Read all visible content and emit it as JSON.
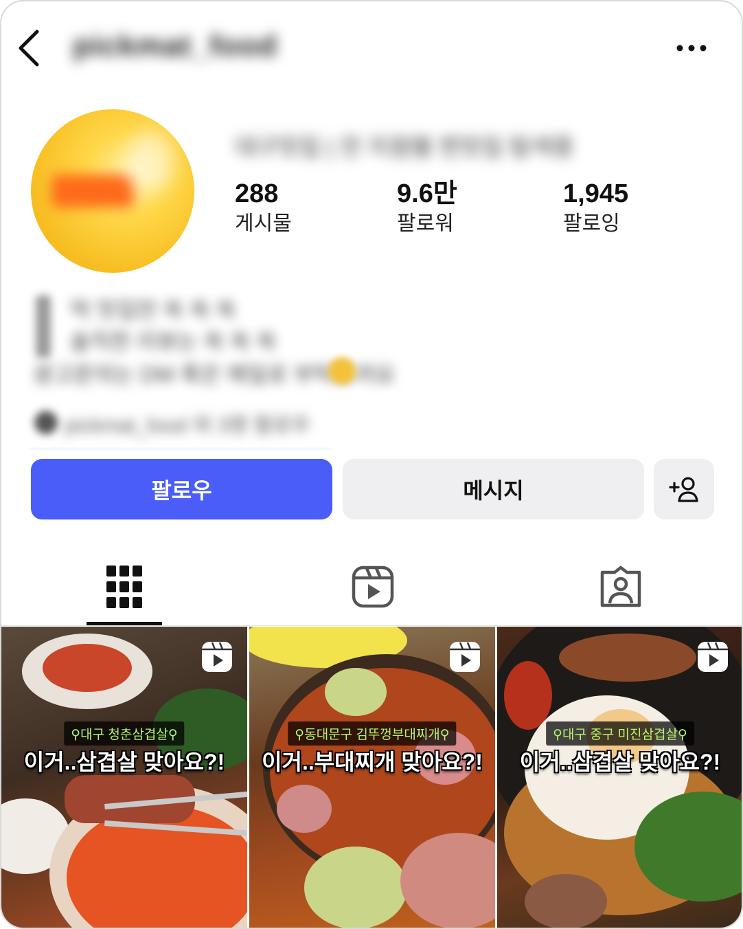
{
  "header": {
    "username": "pickmat_food",
    "back_icon": "chevron-left-icon",
    "more_icon": "more-horizontal-icon"
  },
  "profile": {
    "display_name": "대구맛집 | 전 지점별 찐맛집 탐색중",
    "stats": [
      {
        "value": "288",
        "label": "게시물"
      },
      {
        "value": "9.6만",
        "label": "팔로워"
      },
      {
        "value": "1,945",
        "label": "팔로잉"
      }
    ],
    "bio": [
      "먹 맛집만 쏙 쏙 쏙",
      "솔직한 리뷰는 쏙 쏙 쏙",
      "광고문의는 DM 혹은 메일로 부탁드려요"
    ],
    "link": "pickmat_food 외 3명 팔로우"
  },
  "actions": {
    "follow_label": "팔로우",
    "message_label": "메시지",
    "add_user_icon": "person-add-icon"
  },
  "tabs": [
    {
      "name": "grid",
      "icon": "grid-icon",
      "active": true
    },
    {
      "name": "reels",
      "icon": "reels-icon",
      "active": false
    },
    {
      "name": "tagged",
      "icon": "tagged-person-icon",
      "active": false
    }
  ],
  "posts": [
    {
      "location": "대구 청춘삼겹살",
      "caption": "이거..삼겹살 맞아요?!",
      "type": "reel"
    },
    {
      "location": "동대문구 김뚜껑부대찌개",
      "caption": "이거..부대찌개 맞아요?!",
      "type": "reel"
    },
    {
      "location": "대구 중구 미진삼겹살",
      "caption": "이거..삼겹살 맞아요?!",
      "type": "reel"
    }
  ],
  "colors": {
    "accent": "#4a5df9",
    "button_gray": "#efeff1",
    "location_text": "#b7f56a"
  }
}
